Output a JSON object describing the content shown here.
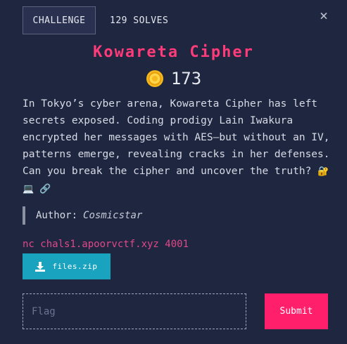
{
  "tabs": {
    "challenge_label": "CHALLENGE",
    "solves_label": "129 SOLVES"
  },
  "close_glyph": "×",
  "challenge": {
    "title": "Kowareta Cipher",
    "points": "173",
    "description": "In Tokyo’s cyber arena, Kowareta Cipher has left secrets exposed. Coding prodigy Lain Iwakura encrypted her messages with AES—but without an IV, patterns emerge, revealing cracks in her defenses. Can you break the cipher and uncover the truth?",
    "description_emojis": "🔐💻 🔗",
    "author_label": "Author:",
    "author_name": "Cosmicstar",
    "connection": "nc chals1.apoorvctf.xyz 4001",
    "file_label": "files.zip"
  },
  "flag_form": {
    "placeholder": "Flag",
    "submit_label": "Submit"
  },
  "colors": {
    "background": "#1f2640",
    "title": "#ff3b7a",
    "accent_download": "#1aa3bf",
    "accent_submit": "#ff1f6a",
    "connection": "#e0488a"
  },
  "icons": {
    "close": "close-icon",
    "coin": "coin-icon",
    "download": "download-icon"
  }
}
